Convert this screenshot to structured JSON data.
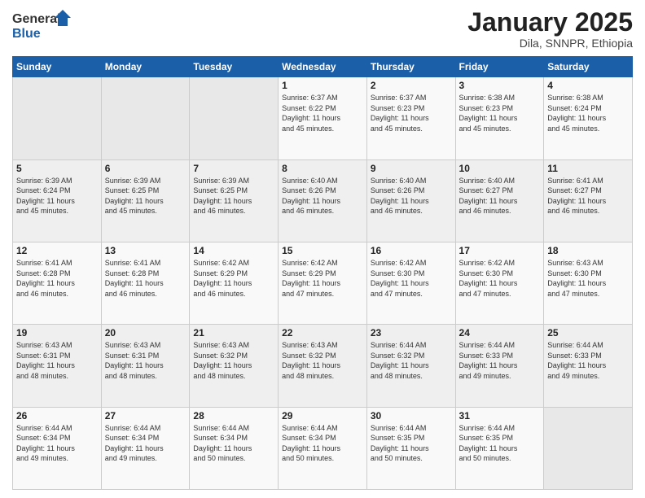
{
  "logo": {
    "line1": "General",
    "line2": "Blue"
  },
  "title": "January 2025",
  "subtitle": "Dila, SNNPR, Ethiopia",
  "days_header": [
    "Sunday",
    "Monday",
    "Tuesday",
    "Wednesday",
    "Thursday",
    "Friday",
    "Saturday"
  ],
  "weeks": [
    [
      {
        "day": "",
        "info": ""
      },
      {
        "day": "",
        "info": ""
      },
      {
        "day": "",
        "info": ""
      },
      {
        "day": "1",
        "info": "Sunrise: 6:37 AM\nSunset: 6:22 PM\nDaylight: 11 hours\nand 45 minutes."
      },
      {
        "day": "2",
        "info": "Sunrise: 6:37 AM\nSunset: 6:23 PM\nDaylight: 11 hours\nand 45 minutes."
      },
      {
        "day": "3",
        "info": "Sunrise: 6:38 AM\nSunset: 6:23 PM\nDaylight: 11 hours\nand 45 minutes."
      },
      {
        "day": "4",
        "info": "Sunrise: 6:38 AM\nSunset: 6:24 PM\nDaylight: 11 hours\nand 45 minutes."
      }
    ],
    [
      {
        "day": "5",
        "info": "Sunrise: 6:39 AM\nSunset: 6:24 PM\nDaylight: 11 hours\nand 45 minutes."
      },
      {
        "day": "6",
        "info": "Sunrise: 6:39 AM\nSunset: 6:25 PM\nDaylight: 11 hours\nand 45 minutes."
      },
      {
        "day": "7",
        "info": "Sunrise: 6:39 AM\nSunset: 6:25 PM\nDaylight: 11 hours\nand 46 minutes."
      },
      {
        "day": "8",
        "info": "Sunrise: 6:40 AM\nSunset: 6:26 PM\nDaylight: 11 hours\nand 46 minutes."
      },
      {
        "day": "9",
        "info": "Sunrise: 6:40 AM\nSunset: 6:26 PM\nDaylight: 11 hours\nand 46 minutes."
      },
      {
        "day": "10",
        "info": "Sunrise: 6:40 AM\nSunset: 6:27 PM\nDaylight: 11 hours\nand 46 minutes."
      },
      {
        "day": "11",
        "info": "Sunrise: 6:41 AM\nSunset: 6:27 PM\nDaylight: 11 hours\nand 46 minutes."
      }
    ],
    [
      {
        "day": "12",
        "info": "Sunrise: 6:41 AM\nSunset: 6:28 PM\nDaylight: 11 hours\nand 46 minutes."
      },
      {
        "day": "13",
        "info": "Sunrise: 6:41 AM\nSunset: 6:28 PM\nDaylight: 11 hours\nand 46 minutes."
      },
      {
        "day": "14",
        "info": "Sunrise: 6:42 AM\nSunset: 6:29 PM\nDaylight: 11 hours\nand 46 minutes."
      },
      {
        "day": "15",
        "info": "Sunrise: 6:42 AM\nSunset: 6:29 PM\nDaylight: 11 hours\nand 47 minutes."
      },
      {
        "day": "16",
        "info": "Sunrise: 6:42 AM\nSunset: 6:30 PM\nDaylight: 11 hours\nand 47 minutes."
      },
      {
        "day": "17",
        "info": "Sunrise: 6:42 AM\nSunset: 6:30 PM\nDaylight: 11 hours\nand 47 minutes."
      },
      {
        "day": "18",
        "info": "Sunrise: 6:43 AM\nSunset: 6:30 PM\nDaylight: 11 hours\nand 47 minutes."
      }
    ],
    [
      {
        "day": "19",
        "info": "Sunrise: 6:43 AM\nSunset: 6:31 PM\nDaylight: 11 hours\nand 48 minutes."
      },
      {
        "day": "20",
        "info": "Sunrise: 6:43 AM\nSunset: 6:31 PM\nDaylight: 11 hours\nand 48 minutes."
      },
      {
        "day": "21",
        "info": "Sunrise: 6:43 AM\nSunset: 6:32 PM\nDaylight: 11 hours\nand 48 minutes."
      },
      {
        "day": "22",
        "info": "Sunrise: 6:43 AM\nSunset: 6:32 PM\nDaylight: 11 hours\nand 48 minutes."
      },
      {
        "day": "23",
        "info": "Sunrise: 6:44 AM\nSunset: 6:32 PM\nDaylight: 11 hours\nand 48 minutes."
      },
      {
        "day": "24",
        "info": "Sunrise: 6:44 AM\nSunset: 6:33 PM\nDaylight: 11 hours\nand 49 minutes."
      },
      {
        "day": "25",
        "info": "Sunrise: 6:44 AM\nSunset: 6:33 PM\nDaylight: 11 hours\nand 49 minutes."
      }
    ],
    [
      {
        "day": "26",
        "info": "Sunrise: 6:44 AM\nSunset: 6:34 PM\nDaylight: 11 hours\nand 49 minutes."
      },
      {
        "day": "27",
        "info": "Sunrise: 6:44 AM\nSunset: 6:34 PM\nDaylight: 11 hours\nand 49 minutes."
      },
      {
        "day": "28",
        "info": "Sunrise: 6:44 AM\nSunset: 6:34 PM\nDaylight: 11 hours\nand 50 minutes."
      },
      {
        "day": "29",
        "info": "Sunrise: 6:44 AM\nSunset: 6:34 PM\nDaylight: 11 hours\nand 50 minutes."
      },
      {
        "day": "30",
        "info": "Sunrise: 6:44 AM\nSunset: 6:35 PM\nDaylight: 11 hours\nand 50 minutes."
      },
      {
        "day": "31",
        "info": "Sunrise: 6:44 AM\nSunset: 6:35 PM\nDaylight: 11 hours\nand 50 minutes."
      },
      {
        "day": "",
        "info": ""
      }
    ]
  ]
}
